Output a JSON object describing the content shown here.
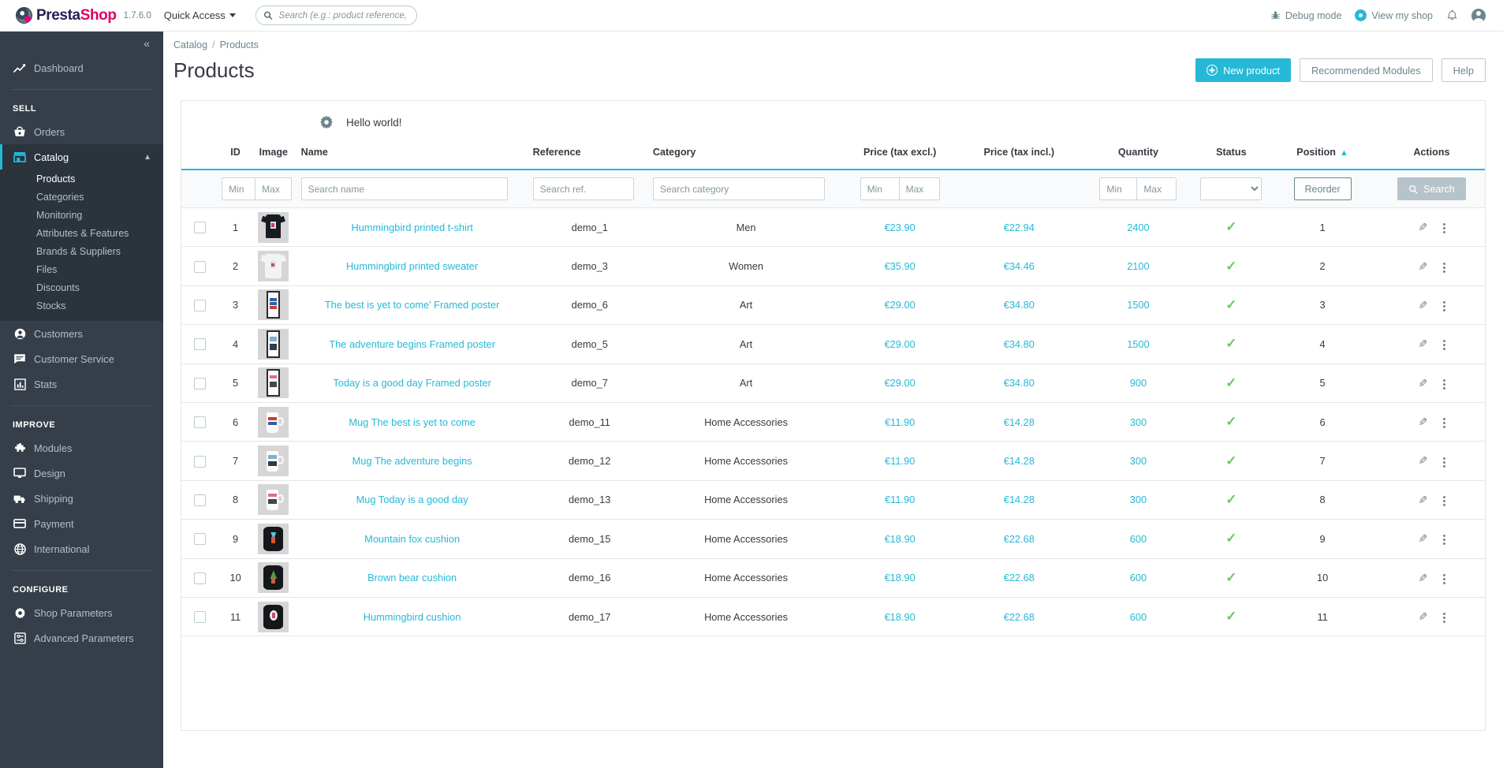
{
  "header": {
    "brand_first": "Presta",
    "brand_second": "Shop",
    "version": "1.7.6.0",
    "quick_access": "Quick Access",
    "search_placeholder": "Search (e.g.: product reference, custome",
    "search_value": "",
    "debug_mode": "Debug mode",
    "view_my_shop": "View my shop",
    "icons": {
      "search": "search-icon",
      "bug": "bug-icon",
      "eye": "eye-icon",
      "bell": "bell-icon",
      "avatar": "avatar-icon"
    }
  },
  "sidebar": {
    "collapse": "«",
    "dashboard": {
      "label": "Dashboard",
      "icon": "chart-line-icon"
    },
    "sections": [
      {
        "title": "SELL",
        "items": [
          {
            "label": "Orders",
            "icon": "basket-icon",
            "active": false
          },
          {
            "label": "Catalog",
            "icon": "store-icon",
            "active": true,
            "children": [
              {
                "label": "Products",
                "active": true
              },
              {
                "label": "Categories",
                "active": false
              },
              {
                "label": "Monitoring",
                "active": false
              },
              {
                "label": "Attributes & Features",
                "active": false
              },
              {
                "label": "Brands & Suppliers",
                "active": false
              },
              {
                "label": "Files",
                "active": false
              },
              {
                "label": "Discounts",
                "active": false
              },
              {
                "label": "Stocks",
                "active": false
              }
            ]
          },
          {
            "label": "Customers",
            "icon": "person-icon",
            "active": false
          },
          {
            "label": "Customer Service",
            "icon": "chat-icon",
            "active": false
          },
          {
            "label": "Stats",
            "icon": "bar-chart-icon",
            "active": false
          }
        ]
      },
      {
        "title": "IMPROVE",
        "items": [
          {
            "label": "Modules",
            "icon": "puzzle-icon",
            "active": false
          },
          {
            "label": "Design",
            "icon": "monitor-icon",
            "active": false
          },
          {
            "label": "Shipping",
            "icon": "truck-icon",
            "active": false
          },
          {
            "label": "Payment",
            "icon": "credit-card-icon",
            "active": false
          },
          {
            "label": "International",
            "icon": "globe-icon",
            "active": false
          }
        ]
      },
      {
        "title": "CONFIGURE",
        "items": [
          {
            "label": "Shop Parameters",
            "icon": "gear-icon",
            "active": false
          },
          {
            "label": "Advanced Parameters",
            "icon": "sliders-icon",
            "active": false
          }
        ]
      }
    ]
  },
  "page": {
    "breadcrumb": {
      "parent": "Catalog",
      "separator": "/",
      "current": "Products"
    },
    "title": "Products",
    "actions": {
      "new_product": "New product",
      "recommended_modules": "Recommended Modules",
      "help": "Help"
    },
    "hello": {
      "text": "Hello world!",
      "icon": "gear-icon"
    }
  },
  "table": {
    "columns": [
      "ID",
      "Image",
      "Name",
      "Reference",
      "Category",
      "Price (tax excl.)",
      "Price (tax incl.)",
      "Quantity",
      "Status",
      "Position",
      "Actions"
    ],
    "sorted_column": "Position",
    "sort_direction": "asc",
    "filters": {
      "id_min": "Min",
      "id_max": "Max",
      "name": "Search name",
      "reference": "Search ref.",
      "category": "Search category",
      "price_excl_min": "Min",
      "price_excl_max": "Max",
      "quantity_min": "Min",
      "quantity_max": "Max",
      "status_selected": "",
      "reorder_label": "Reorder",
      "search_label": "Search"
    },
    "rows": [
      {
        "id": "1",
        "name": "Hummingbird printed t-shirt",
        "reference": "demo_1",
        "category": "Men",
        "price_excl": "€23.90",
        "price_incl": "€22.94",
        "quantity": "2400",
        "status": "enabled",
        "position": "1",
        "img": "tshirt"
      },
      {
        "id": "2",
        "name": "Hummingbird printed sweater",
        "reference": "demo_3",
        "category": "Women",
        "price_excl": "€35.90",
        "price_incl": "€34.46",
        "quantity": "2100",
        "status": "enabled",
        "position": "2",
        "img": "sweater"
      },
      {
        "id": "3",
        "name": "The best is yet to come' Framed poster",
        "reference": "demo_6",
        "category": "Art",
        "price_excl": "€29.00",
        "price_incl": "€34.80",
        "quantity": "1500",
        "status": "enabled",
        "position": "3",
        "img": "poster1"
      },
      {
        "id": "4",
        "name": "The adventure begins Framed poster",
        "reference": "demo_5",
        "category": "Art",
        "price_excl": "€29.00",
        "price_incl": "€34.80",
        "quantity": "1500",
        "status": "enabled",
        "position": "4",
        "img": "poster2"
      },
      {
        "id": "5",
        "name": "Today is a good day Framed poster",
        "reference": "demo_7",
        "category": "Art",
        "price_excl": "€29.00",
        "price_incl": "€34.80",
        "quantity": "900",
        "status": "enabled",
        "position": "5",
        "img": "poster3"
      },
      {
        "id": "6",
        "name": "Mug The best is yet to come",
        "reference": "demo_11",
        "category": "Home Accessories",
        "price_excl": "€11.90",
        "price_incl": "€14.28",
        "quantity": "300",
        "status": "enabled",
        "position": "6",
        "img": "mug1"
      },
      {
        "id": "7",
        "name": "Mug The adventure begins",
        "reference": "demo_12",
        "category": "Home Accessories",
        "price_excl": "€11.90",
        "price_incl": "€14.28",
        "quantity": "300",
        "status": "enabled",
        "position": "7",
        "img": "mug2"
      },
      {
        "id": "8",
        "name": "Mug Today is a good day",
        "reference": "demo_13",
        "category": "Home Accessories",
        "price_excl": "€11.90",
        "price_incl": "€14.28",
        "quantity": "300",
        "status": "enabled",
        "position": "8",
        "img": "mug3"
      },
      {
        "id": "9",
        "name": "Mountain fox cushion",
        "reference": "demo_15",
        "category": "Home Accessories",
        "price_excl": "€18.90",
        "price_incl": "€22.68",
        "quantity": "600",
        "status": "enabled",
        "position": "9",
        "img": "cushion1"
      },
      {
        "id": "10",
        "name": "Brown bear cushion",
        "reference": "demo_16",
        "category": "Home Accessories",
        "price_excl": "€18.90",
        "price_incl": "€22.68",
        "quantity": "600",
        "status": "enabled",
        "position": "10",
        "img": "cushion2"
      },
      {
        "id": "11",
        "name": "Hummingbird cushion",
        "reference": "demo_17",
        "category": "Home Accessories",
        "price_excl": "€18.90",
        "price_incl": "€22.68",
        "quantity": "600",
        "status": "enabled",
        "position": "11",
        "img": "cushion3"
      }
    ]
  },
  "colors": {
    "accent": "#25b9d7",
    "sidebar_bg": "#353e49",
    "sidebar_active_bg": "#2b333d",
    "text": "#363a41",
    "muted": "#6c868e",
    "status_ok": "#6ec664",
    "brand_pink": "#df0067",
    "brand_navy": "#231f55"
  }
}
